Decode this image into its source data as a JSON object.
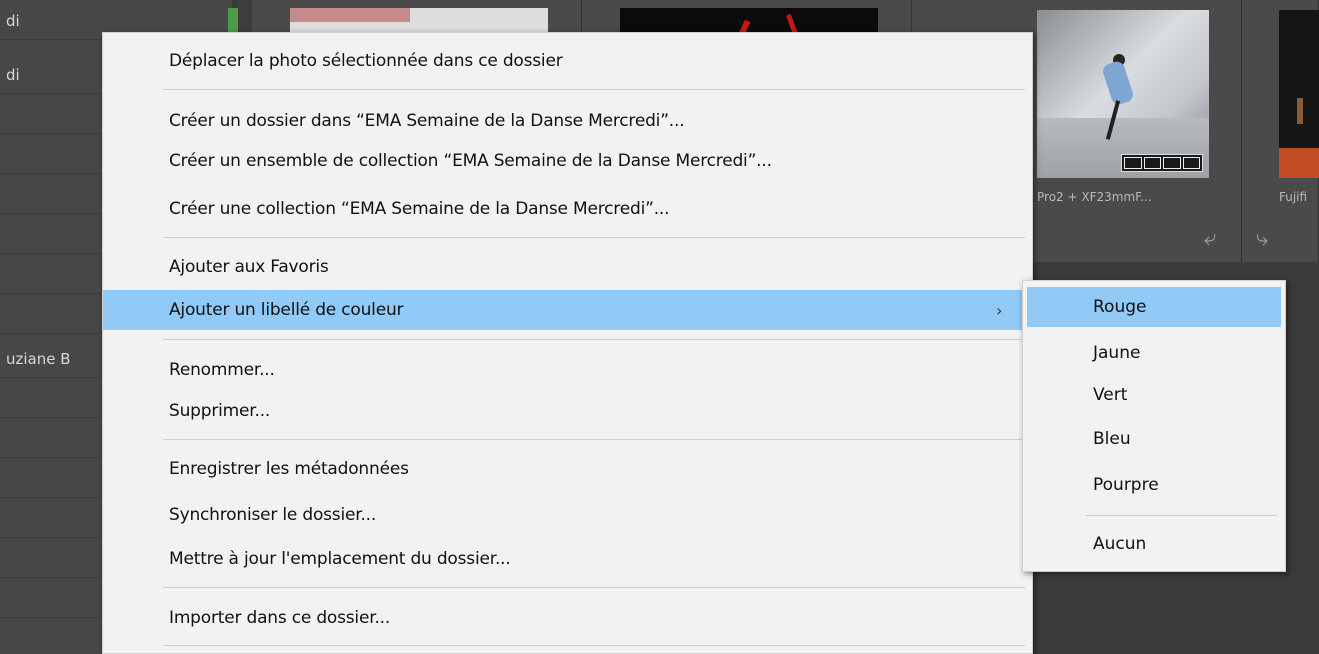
{
  "background": {
    "left_labels": [
      "di",
      "di",
      "uziane B"
    ],
    "captions": [
      "Pro2 + XF23mmF...",
      "Fujifi"
    ],
    "rotate_icons": [
      "rotate-left-icon",
      "rotate-right-icon"
    ]
  },
  "menu": {
    "items": [
      {
        "label": "Déplacer la photo sélectionnée dans ce dossier"
      },
      {
        "label": "Créer un dossier dans “EMA Semaine de la Danse Mercredi”..."
      },
      {
        "label": "Créer un ensemble de collection “EMA Semaine de la Danse Mercredi”..."
      },
      {
        "label": "Créer une collection “EMA Semaine de la Danse Mercredi”..."
      },
      {
        "label": "Ajouter aux Favoris"
      },
      {
        "label": "Ajouter un libellé de couleur",
        "submenu_arrow": "›"
      },
      {
        "label": "Renommer..."
      },
      {
        "label": "Supprimer..."
      },
      {
        "label": "Enregistrer les métadonnées"
      },
      {
        "label": "Synchroniser le dossier..."
      },
      {
        "label": "Mettre à jour l'emplacement du dossier..."
      },
      {
        "label": "Importer dans ce dossier..."
      }
    ]
  },
  "submenu": {
    "items": [
      {
        "label": "Rouge"
      },
      {
        "label": "Jaune"
      },
      {
        "label": "Vert"
      },
      {
        "label": "Bleu"
      },
      {
        "label": "Pourpre"
      },
      {
        "label": "Aucun"
      }
    ]
  },
  "colors": {
    "menu_bg": "#f2f2f2",
    "highlight": "#91c9f7",
    "panel_bg": "#474747"
  }
}
